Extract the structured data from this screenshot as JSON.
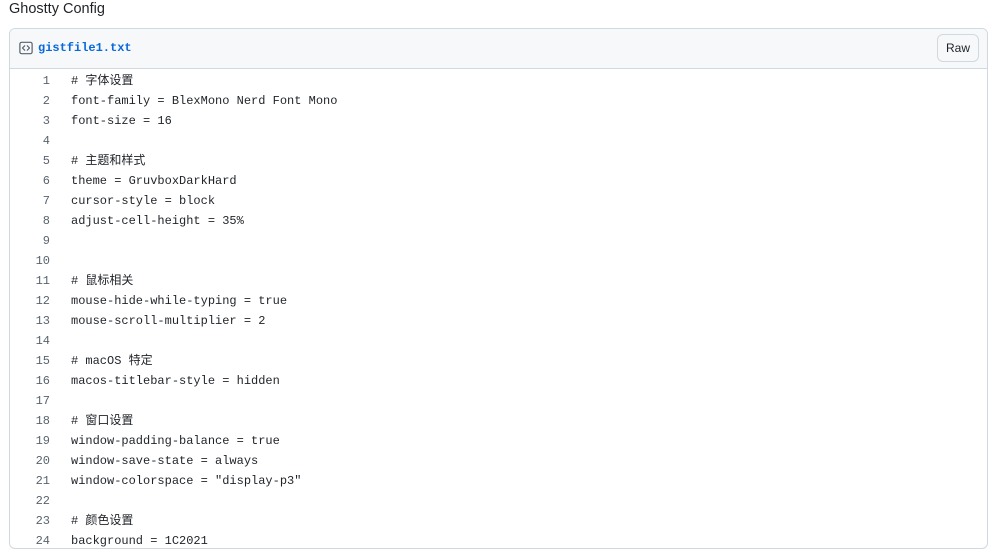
{
  "gist": {
    "title": "Ghostty Config"
  },
  "file": {
    "icon": "code-file-icon",
    "name": "gistfile1.txt",
    "raw_label": "Raw"
  },
  "lines": [
    {
      "num": "1",
      "code": "# 字体设置"
    },
    {
      "num": "2",
      "code": "font-family = BlexMono Nerd Font Mono"
    },
    {
      "num": "3",
      "code": "font-size = 16"
    },
    {
      "num": "4",
      "code": ""
    },
    {
      "num": "5",
      "code": "# 主题和样式"
    },
    {
      "num": "6",
      "code": "theme = GruvboxDarkHard"
    },
    {
      "num": "7",
      "code": "cursor-style = block"
    },
    {
      "num": "8",
      "code": "adjust-cell-height = 35%"
    },
    {
      "num": "9",
      "code": ""
    },
    {
      "num": "10",
      "code": ""
    },
    {
      "num": "11",
      "code": "# 鼠标相关"
    },
    {
      "num": "12",
      "code": "mouse-hide-while-typing = true"
    },
    {
      "num": "13",
      "code": "mouse-scroll-multiplier = 2"
    },
    {
      "num": "14",
      "code": ""
    },
    {
      "num": "15",
      "code": "# macOS 特定"
    },
    {
      "num": "16",
      "code": "macos-titlebar-style = hidden"
    },
    {
      "num": "17",
      "code": ""
    },
    {
      "num": "18",
      "code": "# 窗口设置"
    },
    {
      "num": "19",
      "code": "window-padding-balance = true"
    },
    {
      "num": "20",
      "code": "window-save-state = always"
    },
    {
      "num": "21",
      "code": "window-colorspace = \"display-p3\""
    },
    {
      "num": "22",
      "code": ""
    },
    {
      "num": "23",
      "code": "# 颜色设置"
    },
    {
      "num": "24",
      "code": "background = 1C2021"
    }
  ]
}
